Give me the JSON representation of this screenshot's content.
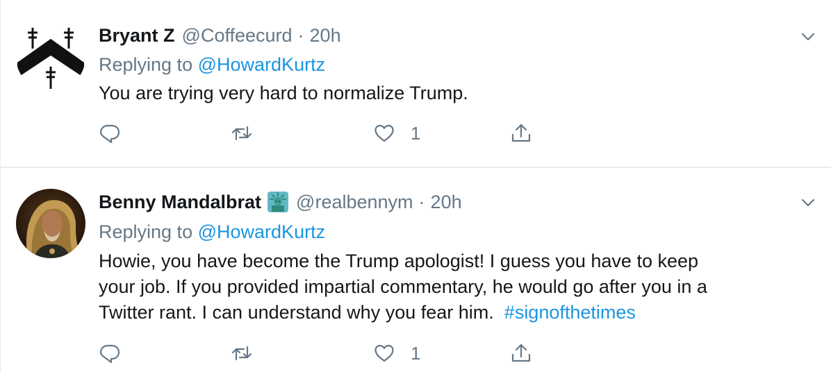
{
  "tweets": [
    {
      "name": "Bryant Z",
      "handle": "@Coffeecurd",
      "separator": "·",
      "time": "20h",
      "replying_prefix": "Replying to",
      "replying_mention": "@HowardKurtz",
      "text_lines": [
        "You are trying very hard to normalize Trump."
      ],
      "like_count": "1",
      "avatar_icon": "crosses-chevron-logo-icon"
    },
    {
      "name": "Benny Mandalbrat",
      "handle": "@realbennym",
      "separator": "·",
      "time": "20h",
      "replying_prefix": "Replying to",
      "replying_mention": "@HowardKurtz",
      "text_lines": [
        "Howie, you have become the Trump apologist!  I guess you have to keep",
        "your job.  If you provided impartial commentary, he would go after you in a",
        "Twitter rant.  I can understand why you fear him."
      ],
      "hashtag": "#signofthetimes",
      "like_count": "1",
      "badge_icon": "statue-of-liberty-emoji-icon"
    }
  ],
  "colors": {
    "link": "#1b95e0",
    "secondary": "#657786",
    "text": "#14171a",
    "divider": "#e6ecf0"
  }
}
